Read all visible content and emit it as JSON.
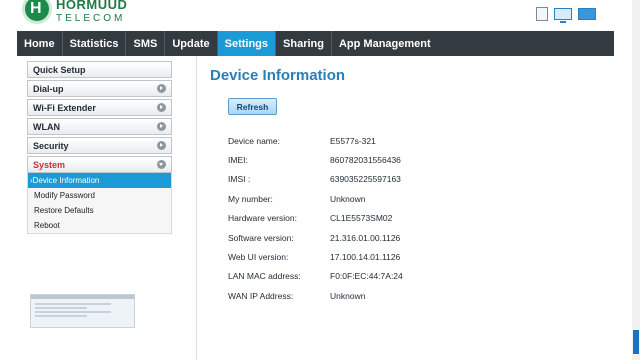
{
  "brand": {
    "line1": "HORMUUD",
    "line2": "TELECOM"
  },
  "view_modes": [
    {
      "icon": "mobile-view-icon"
    },
    {
      "icon": "desktop-view-icon"
    },
    {
      "icon": "tablet-view-icon"
    }
  ],
  "nav": {
    "items": [
      {
        "label": "Home",
        "active": false
      },
      {
        "label": "Statistics",
        "active": false
      },
      {
        "label": "SMS",
        "active": false
      },
      {
        "label": "Update",
        "active": false
      },
      {
        "label": "Settings",
        "active": true
      },
      {
        "label": "Sharing",
        "active": false
      },
      {
        "label": "App Management",
        "active": false
      }
    ]
  },
  "sidebar": {
    "items": [
      {
        "label": "Quick Setup"
      },
      {
        "label": "Dial-up"
      },
      {
        "label": "Wi-Fi Extender"
      },
      {
        "label": "WLAN"
      },
      {
        "label": "Security"
      },
      {
        "label": "System"
      }
    ],
    "system_sub": [
      {
        "label": "Device Information",
        "active": true
      },
      {
        "label": "Modify Password",
        "active": false
      },
      {
        "label": "Restore Defaults",
        "active": false
      },
      {
        "label": "Reboot",
        "active": false
      }
    ]
  },
  "main": {
    "title": "Device Information",
    "refresh_label": "Refresh",
    "rows": [
      {
        "label": "Device name:",
        "value": "E5577s-321"
      },
      {
        "label": "IMEI:",
        "value": "860782031556436"
      },
      {
        "label": "IMSI :",
        "value": "639035225597163"
      },
      {
        "label": "My number:",
        "value": "Unknown"
      },
      {
        "label": "Hardware version:",
        "value": "CL1E5573SM02"
      },
      {
        "label": "Software version:",
        "value": "21.316.01.00.1126"
      },
      {
        "label": "Web UI version:",
        "value": "17.100.14.01.1126"
      },
      {
        "label": "LAN MAC address:",
        "value": "F0:0F:EC:44:7A:24"
      },
      {
        "label": "WAN IP Address:",
        "value": "Unknown"
      }
    ]
  },
  "colors": {
    "nav_bg": "#333a40",
    "accent": "#1b9ad6",
    "title": "#2a7fb4",
    "brand_green": "#1e7a44"
  }
}
